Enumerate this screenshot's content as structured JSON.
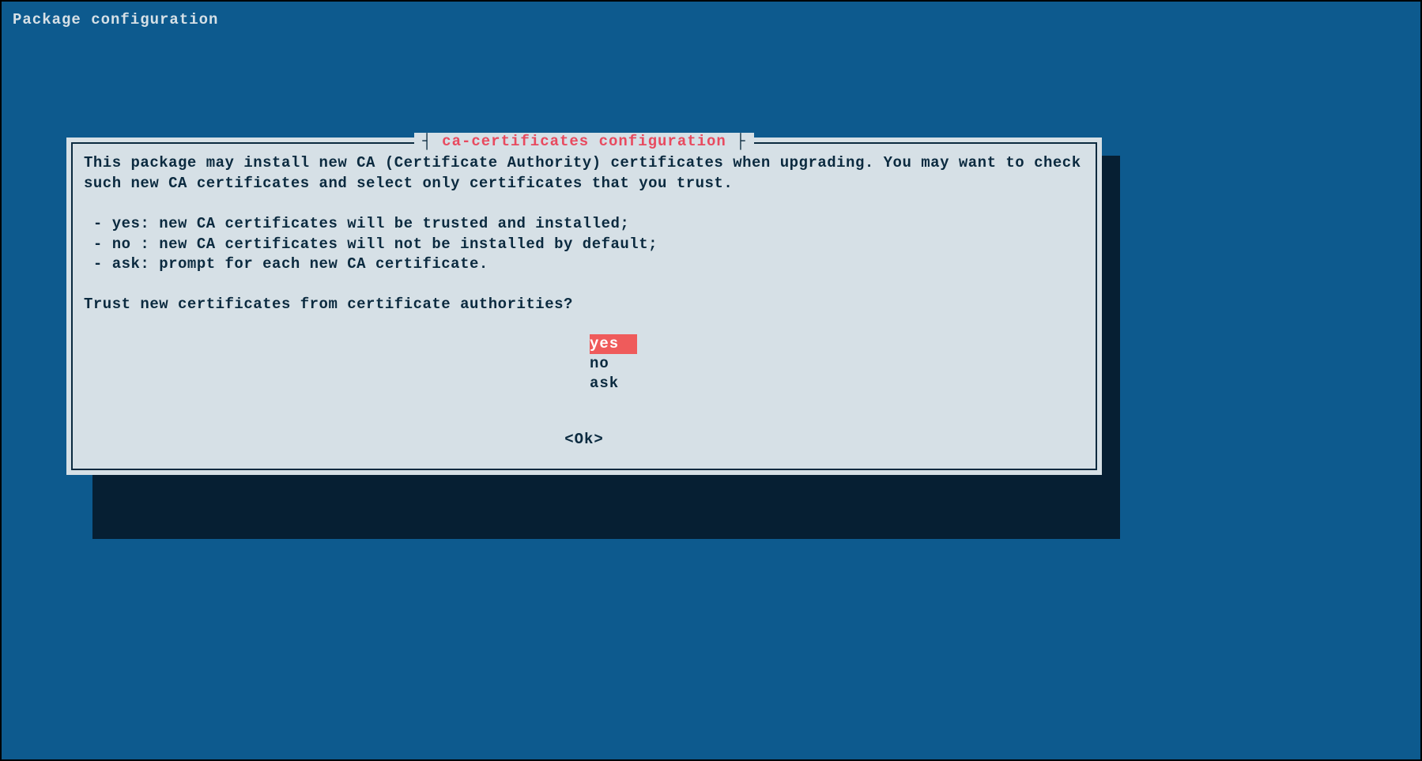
{
  "page_title": "Package configuration",
  "dialog": {
    "title": "ca-certificates configuration",
    "body_intro": "This package may install new CA (Certificate Authority) certificates when upgrading. You may want to check such new CA certificates and select only certificates that you trust.",
    "bullet_yes": " - yes: new CA certificates will be trusted and installed;",
    "bullet_no": " - no : new CA certificates will not be installed by default;",
    "bullet_ask": " - ask: prompt for each new CA certificate.",
    "prompt": "Trust new certificates from certificate authorities?",
    "options": {
      "yes": "yes",
      "no": "no",
      "ask": "ask",
      "selected": "yes"
    },
    "ok_label": "<Ok>"
  }
}
